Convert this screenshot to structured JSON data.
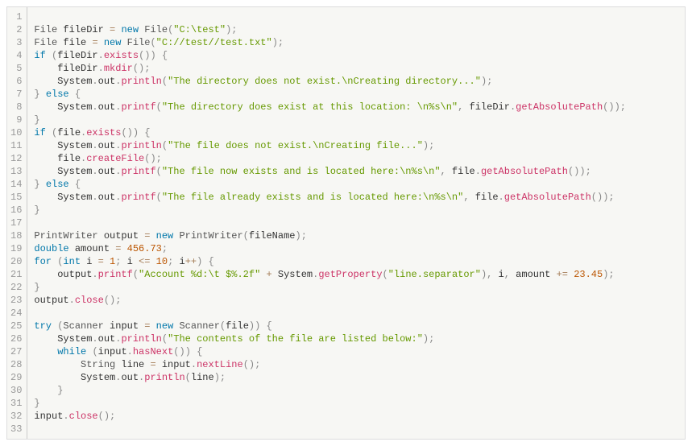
{
  "lineCount": 33,
  "code": {
    "lines": [
      [],
      [
        {
          "t": "type",
          "v": "File"
        },
        {
          "t": "plain",
          "v": " fileDir "
        },
        {
          "t": "op",
          "v": "="
        },
        {
          "t": "plain",
          "v": " "
        },
        {
          "t": "kw",
          "v": "new"
        },
        {
          "t": "plain",
          "v": " "
        },
        {
          "t": "type",
          "v": "File"
        },
        {
          "t": "punct",
          "v": "("
        },
        {
          "t": "str",
          "v": "\"C:\\test\""
        },
        {
          "t": "punct",
          "v": ")"
        },
        {
          "t": "punct",
          "v": ";"
        }
      ],
      [
        {
          "t": "type",
          "v": "File"
        },
        {
          "t": "plain",
          "v": " file "
        },
        {
          "t": "op",
          "v": "="
        },
        {
          "t": "plain",
          "v": " "
        },
        {
          "t": "kw",
          "v": "new"
        },
        {
          "t": "plain",
          "v": " "
        },
        {
          "t": "type",
          "v": "File"
        },
        {
          "t": "punct",
          "v": "("
        },
        {
          "t": "str",
          "v": "\"C://test//test.txt\""
        },
        {
          "t": "punct",
          "v": ")"
        },
        {
          "t": "punct",
          "v": ";"
        }
      ],
      [
        {
          "t": "kw",
          "v": "if"
        },
        {
          "t": "plain",
          "v": " "
        },
        {
          "t": "punct",
          "v": "("
        },
        {
          "t": "plain",
          "v": "fileDir"
        },
        {
          "t": "punct",
          "v": "."
        },
        {
          "t": "fn",
          "v": "exists"
        },
        {
          "t": "punct",
          "v": "("
        },
        {
          "t": "punct",
          "v": ")"
        },
        {
          "t": "punct",
          "v": ")"
        },
        {
          "t": "plain",
          "v": " "
        },
        {
          "t": "punct",
          "v": "{"
        }
      ],
      [
        {
          "t": "plain",
          "v": "    fileDir"
        },
        {
          "t": "punct",
          "v": "."
        },
        {
          "t": "fn",
          "v": "mkdir"
        },
        {
          "t": "punct",
          "v": "("
        },
        {
          "t": "punct",
          "v": ")"
        },
        {
          "t": "punct",
          "v": ";"
        }
      ],
      [
        {
          "t": "plain",
          "v": "    System"
        },
        {
          "t": "punct",
          "v": "."
        },
        {
          "t": "plain",
          "v": "out"
        },
        {
          "t": "punct",
          "v": "."
        },
        {
          "t": "fn",
          "v": "println"
        },
        {
          "t": "punct",
          "v": "("
        },
        {
          "t": "str",
          "v": "\"The directory does not exist.\\nCreating directory...\""
        },
        {
          "t": "punct",
          "v": ")"
        },
        {
          "t": "punct",
          "v": ";"
        }
      ],
      [
        {
          "t": "punct",
          "v": "}"
        },
        {
          "t": "plain",
          "v": " "
        },
        {
          "t": "kw",
          "v": "else"
        },
        {
          "t": "plain",
          "v": " "
        },
        {
          "t": "punct",
          "v": "{"
        }
      ],
      [
        {
          "t": "plain",
          "v": "    System"
        },
        {
          "t": "punct",
          "v": "."
        },
        {
          "t": "plain",
          "v": "out"
        },
        {
          "t": "punct",
          "v": "."
        },
        {
          "t": "fn",
          "v": "printf"
        },
        {
          "t": "punct",
          "v": "("
        },
        {
          "t": "str",
          "v": "\"The directory does exist at this location: \\n%s\\n\""
        },
        {
          "t": "punct",
          "v": ","
        },
        {
          "t": "plain",
          "v": " fileDir"
        },
        {
          "t": "punct",
          "v": "."
        },
        {
          "t": "fn",
          "v": "getAbsolutePath"
        },
        {
          "t": "punct",
          "v": "("
        },
        {
          "t": "punct",
          "v": ")"
        },
        {
          "t": "punct",
          "v": ")"
        },
        {
          "t": "punct",
          "v": ";"
        }
      ],
      [
        {
          "t": "punct",
          "v": "}"
        }
      ],
      [
        {
          "t": "kw",
          "v": "if"
        },
        {
          "t": "plain",
          "v": " "
        },
        {
          "t": "punct",
          "v": "("
        },
        {
          "t": "plain",
          "v": "file"
        },
        {
          "t": "punct",
          "v": "."
        },
        {
          "t": "fn",
          "v": "exists"
        },
        {
          "t": "punct",
          "v": "("
        },
        {
          "t": "punct",
          "v": ")"
        },
        {
          "t": "punct",
          "v": ")"
        },
        {
          "t": "plain",
          "v": " "
        },
        {
          "t": "punct",
          "v": "{"
        }
      ],
      [
        {
          "t": "plain",
          "v": "    System"
        },
        {
          "t": "punct",
          "v": "."
        },
        {
          "t": "plain",
          "v": "out"
        },
        {
          "t": "punct",
          "v": "."
        },
        {
          "t": "fn",
          "v": "println"
        },
        {
          "t": "punct",
          "v": "("
        },
        {
          "t": "str",
          "v": "\"The file does not exist.\\nCreating file...\""
        },
        {
          "t": "punct",
          "v": ")"
        },
        {
          "t": "punct",
          "v": ";"
        }
      ],
      [
        {
          "t": "plain",
          "v": "    file"
        },
        {
          "t": "punct",
          "v": "."
        },
        {
          "t": "fn",
          "v": "createFile"
        },
        {
          "t": "punct",
          "v": "("
        },
        {
          "t": "punct",
          "v": ")"
        },
        {
          "t": "punct",
          "v": ";"
        }
      ],
      [
        {
          "t": "plain",
          "v": "    System"
        },
        {
          "t": "punct",
          "v": "."
        },
        {
          "t": "plain",
          "v": "out"
        },
        {
          "t": "punct",
          "v": "."
        },
        {
          "t": "fn",
          "v": "printf"
        },
        {
          "t": "punct",
          "v": "("
        },
        {
          "t": "str",
          "v": "\"The file now exists and is located here:\\n%s\\n\""
        },
        {
          "t": "punct",
          "v": ","
        },
        {
          "t": "plain",
          "v": " file"
        },
        {
          "t": "punct",
          "v": "."
        },
        {
          "t": "fn",
          "v": "getAbsolutePath"
        },
        {
          "t": "punct",
          "v": "("
        },
        {
          "t": "punct",
          "v": ")"
        },
        {
          "t": "punct",
          "v": ")"
        },
        {
          "t": "punct",
          "v": ";"
        }
      ],
      [
        {
          "t": "punct",
          "v": "}"
        },
        {
          "t": "plain",
          "v": " "
        },
        {
          "t": "kw",
          "v": "else"
        },
        {
          "t": "plain",
          "v": " "
        },
        {
          "t": "punct",
          "v": "{"
        }
      ],
      [
        {
          "t": "plain",
          "v": "    System"
        },
        {
          "t": "punct",
          "v": "."
        },
        {
          "t": "plain",
          "v": "out"
        },
        {
          "t": "punct",
          "v": "."
        },
        {
          "t": "fn",
          "v": "printf"
        },
        {
          "t": "punct",
          "v": "("
        },
        {
          "t": "str",
          "v": "\"The file already exists and is located here:\\n%s\\n\""
        },
        {
          "t": "punct",
          "v": ","
        },
        {
          "t": "plain",
          "v": " file"
        },
        {
          "t": "punct",
          "v": "."
        },
        {
          "t": "fn",
          "v": "getAbsolutePath"
        },
        {
          "t": "punct",
          "v": "("
        },
        {
          "t": "punct",
          "v": ")"
        },
        {
          "t": "punct",
          "v": ")"
        },
        {
          "t": "punct",
          "v": ";"
        }
      ],
      [
        {
          "t": "punct",
          "v": "}"
        }
      ],
      [],
      [
        {
          "t": "type",
          "v": "PrintWriter"
        },
        {
          "t": "plain",
          "v": " output "
        },
        {
          "t": "op",
          "v": "="
        },
        {
          "t": "plain",
          "v": " "
        },
        {
          "t": "kw",
          "v": "new"
        },
        {
          "t": "plain",
          "v": " "
        },
        {
          "t": "type",
          "v": "PrintWriter"
        },
        {
          "t": "punct",
          "v": "("
        },
        {
          "t": "plain",
          "v": "fileName"
        },
        {
          "t": "punct",
          "v": ")"
        },
        {
          "t": "punct",
          "v": ";"
        }
      ],
      [
        {
          "t": "kw",
          "v": "double"
        },
        {
          "t": "plain",
          "v": " amount "
        },
        {
          "t": "op",
          "v": "="
        },
        {
          "t": "plain",
          "v": " "
        },
        {
          "t": "num",
          "v": "456.73"
        },
        {
          "t": "punct",
          "v": ";"
        }
      ],
      [
        {
          "t": "kw",
          "v": "for"
        },
        {
          "t": "plain",
          "v": " "
        },
        {
          "t": "punct",
          "v": "("
        },
        {
          "t": "kw",
          "v": "int"
        },
        {
          "t": "plain",
          "v": " i "
        },
        {
          "t": "op",
          "v": "="
        },
        {
          "t": "plain",
          "v": " "
        },
        {
          "t": "num",
          "v": "1"
        },
        {
          "t": "punct",
          "v": ";"
        },
        {
          "t": "plain",
          "v": " i "
        },
        {
          "t": "op",
          "v": "<="
        },
        {
          "t": "plain",
          "v": " "
        },
        {
          "t": "num",
          "v": "10"
        },
        {
          "t": "punct",
          "v": ";"
        },
        {
          "t": "plain",
          "v": " i"
        },
        {
          "t": "op",
          "v": "++"
        },
        {
          "t": "punct",
          "v": ")"
        },
        {
          "t": "plain",
          "v": " "
        },
        {
          "t": "punct",
          "v": "{"
        }
      ],
      [
        {
          "t": "plain",
          "v": "    output"
        },
        {
          "t": "punct",
          "v": "."
        },
        {
          "t": "fn",
          "v": "printf"
        },
        {
          "t": "punct",
          "v": "("
        },
        {
          "t": "str",
          "v": "\"Account %d:\\t $%.2f\""
        },
        {
          "t": "plain",
          "v": " "
        },
        {
          "t": "op",
          "v": "+"
        },
        {
          "t": "plain",
          "v": " System"
        },
        {
          "t": "punct",
          "v": "."
        },
        {
          "t": "fn",
          "v": "getProperty"
        },
        {
          "t": "punct",
          "v": "("
        },
        {
          "t": "str",
          "v": "\"line.separator\""
        },
        {
          "t": "punct",
          "v": ")"
        },
        {
          "t": "punct",
          "v": ","
        },
        {
          "t": "plain",
          "v": " i"
        },
        {
          "t": "punct",
          "v": ","
        },
        {
          "t": "plain",
          "v": " amount "
        },
        {
          "t": "op",
          "v": "+="
        },
        {
          "t": "plain",
          "v": " "
        },
        {
          "t": "num",
          "v": "23.45"
        },
        {
          "t": "punct",
          "v": ")"
        },
        {
          "t": "punct",
          "v": ";"
        }
      ],
      [
        {
          "t": "punct",
          "v": "}"
        }
      ],
      [
        {
          "t": "plain",
          "v": "output"
        },
        {
          "t": "punct",
          "v": "."
        },
        {
          "t": "fn",
          "v": "close"
        },
        {
          "t": "punct",
          "v": "("
        },
        {
          "t": "punct",
          "v": ")"
        },
        {
          "t": "punct",
          "v": ";"
        }
      ],
      [],
      [
        {
          "t": "kw",
          "v": "try"
        },
        {
          "t": "plain",
          "v": " "
        },
        {
          "t": "punct",
          "v": "("
        },
        {
          "t": "type",
          "v": "Scanner"
        },
        {
          "t": "plain",
          "v": " input "
        },
        {
          "t": "op",
          "v": "="
        },
        {
          "t": "plain",
          "v": " "
        },
        {
          "t": "kw",
          "v": "new"
        },
        {
          "t": "plain",
          "v": " "
        },
        {
          "t": "type",
          "v": "Scanner"
        },
        {
          "t": "punct",
          "v": "("
        },
        {
          "t": "plain",
          "v": "file"
        },
        {
          "t": "punct",
          "v": ")"
        },
        {
          "t": "punct",
          "v": ")"
        },
        {
          "t": "plain",
          "v": " "
        },
        {
          "t": "punct",
          "v": "{"
        }
      ],
      [
        {
          "t": "plain",
          "v": "    System"
        },
        {
          "t": "punct",
          "v": "."
        },
        {
          "t": "plain",
          "v": "out"
        },
        {
          "t": "punct",
          "v": "."
        },
        {
          "t": "fn",
          "v": "println"
        },
        {
          "t": "punct",
          "v": "("
        },
        {
          "t": "str",
          "v": "\"The contents of the file are listed below:\""
        },
        {
          "t": "punct",
          "v": ")"
        },
        {
          "t": "punct",
          "v": ";"
        }
      ],
      [
        {
          "t": "plain",
          "v": "    "
        },
        {
          "t": "kw",
          "v": "while"
        },
        {
          "t": "plain",
          "v": " "
        },
        {
          "t": "punct",
          "v": "("
        },
        {
          "t": "plain",
          "v": "input"
        },
        {
          "t": "punct",
          "v": "."
        },
        {
          "t": "fn",
          "v": "hasNext"
        },
        {
          "t": "punct",
          "v": "("
        },
        {
          "t": "punct",
          "v": ")"
        },
        {
          "t": "punct",
          "v": ")"
        },
        {
          "t": "plain",
          "v": " "
        },
        {
          "t": "punct",
          "v": "{"
        }
      ],
      [
        {
          "t": "plain",
          "v": "        "
        },
        {
          "t": "type",
          "v": "String"
        },
        {
          "t": "plain",
          "v": " line "
        },
        {
          "t": "op",
          "v": "="
        },
        {
          "t": "plain",
          "v": " input"
        },
        {
          "t": "punct",
          "v": "."
        },
        {
          "t": "fn",
          "v": "nextLine"
        },
        {
          "t": "punct",
          "v": "("
        },
        {
          "t": "punct",
          "v": ")"
        },
        {
          "t": "punct",
          "v": ";"
        }
      ],
      [
        {
          "t": "plain",
          "v": "        System"
        },
        {
          "t": "punct",
          "v": "."
        },
        {
          "t": "plain",
          "v": "out"
        },
        {
          "t": "punct",
          "v": "."
        },
        {
          "t": "fn",
          "v": "println"
        },
        {
          "t": "punct",
          "v": "("
        },
        {
          "t": "plain",
          "v": "line"
        },
        {
          "t": "punct",
          "v": ")"
        },
        {
          "t": "punct",
          "v": ";"
        }
      ],
      [
        {
          "t": "plain",
          "v": "    "
        },
        {
          "t": "punct",
          "v": "}"
        }
      ],
      [
        {
          "t": "punct",
          "v": "}"
        }
      ],
      [
        {
          "t": "plain",
          "v": "input"
        },
        {
          "t": "punct",
          "v": "."
        },
        {
          "t": "fn",
          "v": "close"
        },
        {
          "t": "punct",
          "v": "("
        },
        {
          "t": "punct",
          "v": ")"
        },
        {
          "t": "punct",
          "v": ";"
        }
      ],
      []
    ]
  }
}
